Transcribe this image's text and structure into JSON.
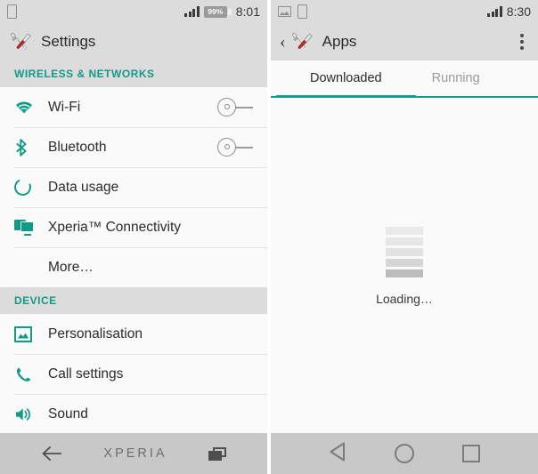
{
  "left_screen": {
    "status_bar": {
      "time": "8:01",
      "battery_percent": "99%",
      "icons": [
        "sim-card-icon",
        "signal-icon",
        "battery-charging-icon"
      ]
    },
    "action_bar": {
      "title": "Settings",
      "icon": "tools-icon"
    },
    "sections": [
      {
        "header": "WIRELESS & NETWORKS",
        "rows": [
          {
            "label": "Wi-Fi",
            "icon": "wifi-icon",
            "control": "toggle-switch",
            "control_state": "off"
          },
          {
            "label": "Bluetooth",
            "icon": "bluetooth-icon",
            "control": "toggle-switch",
            "control_state": "off"
          },
          {
            "label": "Data usage",
            "icon": "data-usage-icon",
            "control": "none",
            "control_state": ""
          },
          {
            "label": "Xperia™ Connectivity",
            "icon": "xperia-connectivity-icon",
            "control": "none",
            "control_state": ""
          },
          {
            "label": "More…",
            "icon": "none",
            "control": "none",
            "control_state": ""
          }
        ]
      },
      {
        "header": "DEVICE",
        "rows": [
          {
            "label": "Personalisation",
            "icon": "image-icon",
            "control": "none",
            "control_state": ""
          },
          {
            "label": "Call settings",
            "icon": "phone-icon",
            "control": "none",
            "control_state": ""
          },
          {
            "label": "Sound",
            "icon": "speaker-icon",
            "control": "none",
            "control_state": ""
          }
        ]
      }
    ],
    "nav_bar": {
      "back": "back-arrow-icon",
      "brand": "XPERIA",
      "recents": "recents-icon"
    }
  },
  "right_screen": {
    "status_bar": {
      "time": "8:30",
      "icons": [
        "image-icon",
        "sim-card-icon",
        "signal-icon"
      ]
    },
    "action_bar": {
      "back": "chevron-left-icon",
      "icon": "tools-icon",
      "title": "Apps",
      "overflow": "overflow-menu-icon"
    },
    "tabs": [
      {
        "label": "Downloaded",
        "active": true
      },
      {
        "label": "Running",
        "active": false
      }
    ],
    "content": {
      "loading_text": "Loading…",
      "loading_indicator": "loading-bars-icon"
    },
    "nav_bar": {
      "back": "triangle-back-icon",
      "home": "circle-home-icon",
      "recents": "square-recents-icon"
    }
  },
  "colors": {
    "accent_teal": "#0f9b84",
    "bar_gray": "#dcdcdc",
    "list_bg": "#fafafa",
    "navbar_gray": "#c8c8c8",
    "text_primary": "#2b2b2b",
    "text_muted": "#9a9a9a"
  }
}
